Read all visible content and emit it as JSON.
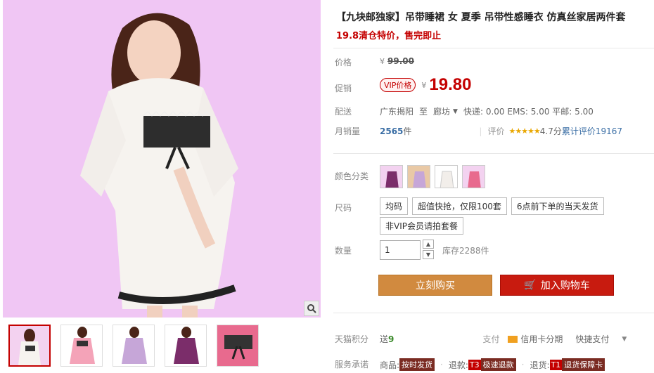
{
  "product": {
    "title": "【九块邮独家】吊带睡裙 女 夏季 吊带性感睡衣 仿真丝家居两件套",
    "subtitle": "19.8清仓特价，售完即止"
  },
  "price": {
    "label": "价格",
    "currency": "¥",
    "original": "99.00"
  },
  "promo": {
    "label": "促销",
    "vip_tag": "VIP价格",
    "currency": "¥",
    "value": "19.80"
  },
  "delivery": {
    "label": "配送",
    "from": "广东揭阳",
    "to_word": "至",
    "to": "廊坊",
    "fees": "快递: 0.00 EMS: 5.00 平邮: 5.00"
  },
  "sales": {
    "label": "月销量",
    "count": "2565",
    "unit": "件",
    "review_label": "评价",
    "rating": "4.7分",
    "reviews": "累计评价19167"
  },
  "color": {
    "label": "颜色分类"
  },
  "size": {
    "label": "尺码",
    "options": [
      "均码",
      "超值快抢，仅限100套",
      "6点前下单的当天发货",
      "非VIP会员请拍套餐"
    ]
  },
  "quantity": {
    "label": "数量",
    "value": "1",
    "stock": "库存2288件"
  },
  "actions": {
    "buy": "立刻购买",
    "cart": "加入购物车"
  },
  "points": {
    "label": "天猫积分",
    "give": "送",
    "value": "9",
    "pay_label": "支付",
    "credit": "信用卡分期",
    "quick": "快捷支付"
  },
  "promise": {
    "label": "服务承诺",
    "goods": "商品:",
    "goods_tag": "按时发货",
    "refund": "退款:",
    "refund_t": "T3",
    "refund_tag": "极速退款",
    "return": "退货:",
    "return_t": "T1",
    "return_tag": "退货保障卡"
  },
  "colors": {
    "accent": "#c40000",
    "background": "#f0c6f4"
  }
}
